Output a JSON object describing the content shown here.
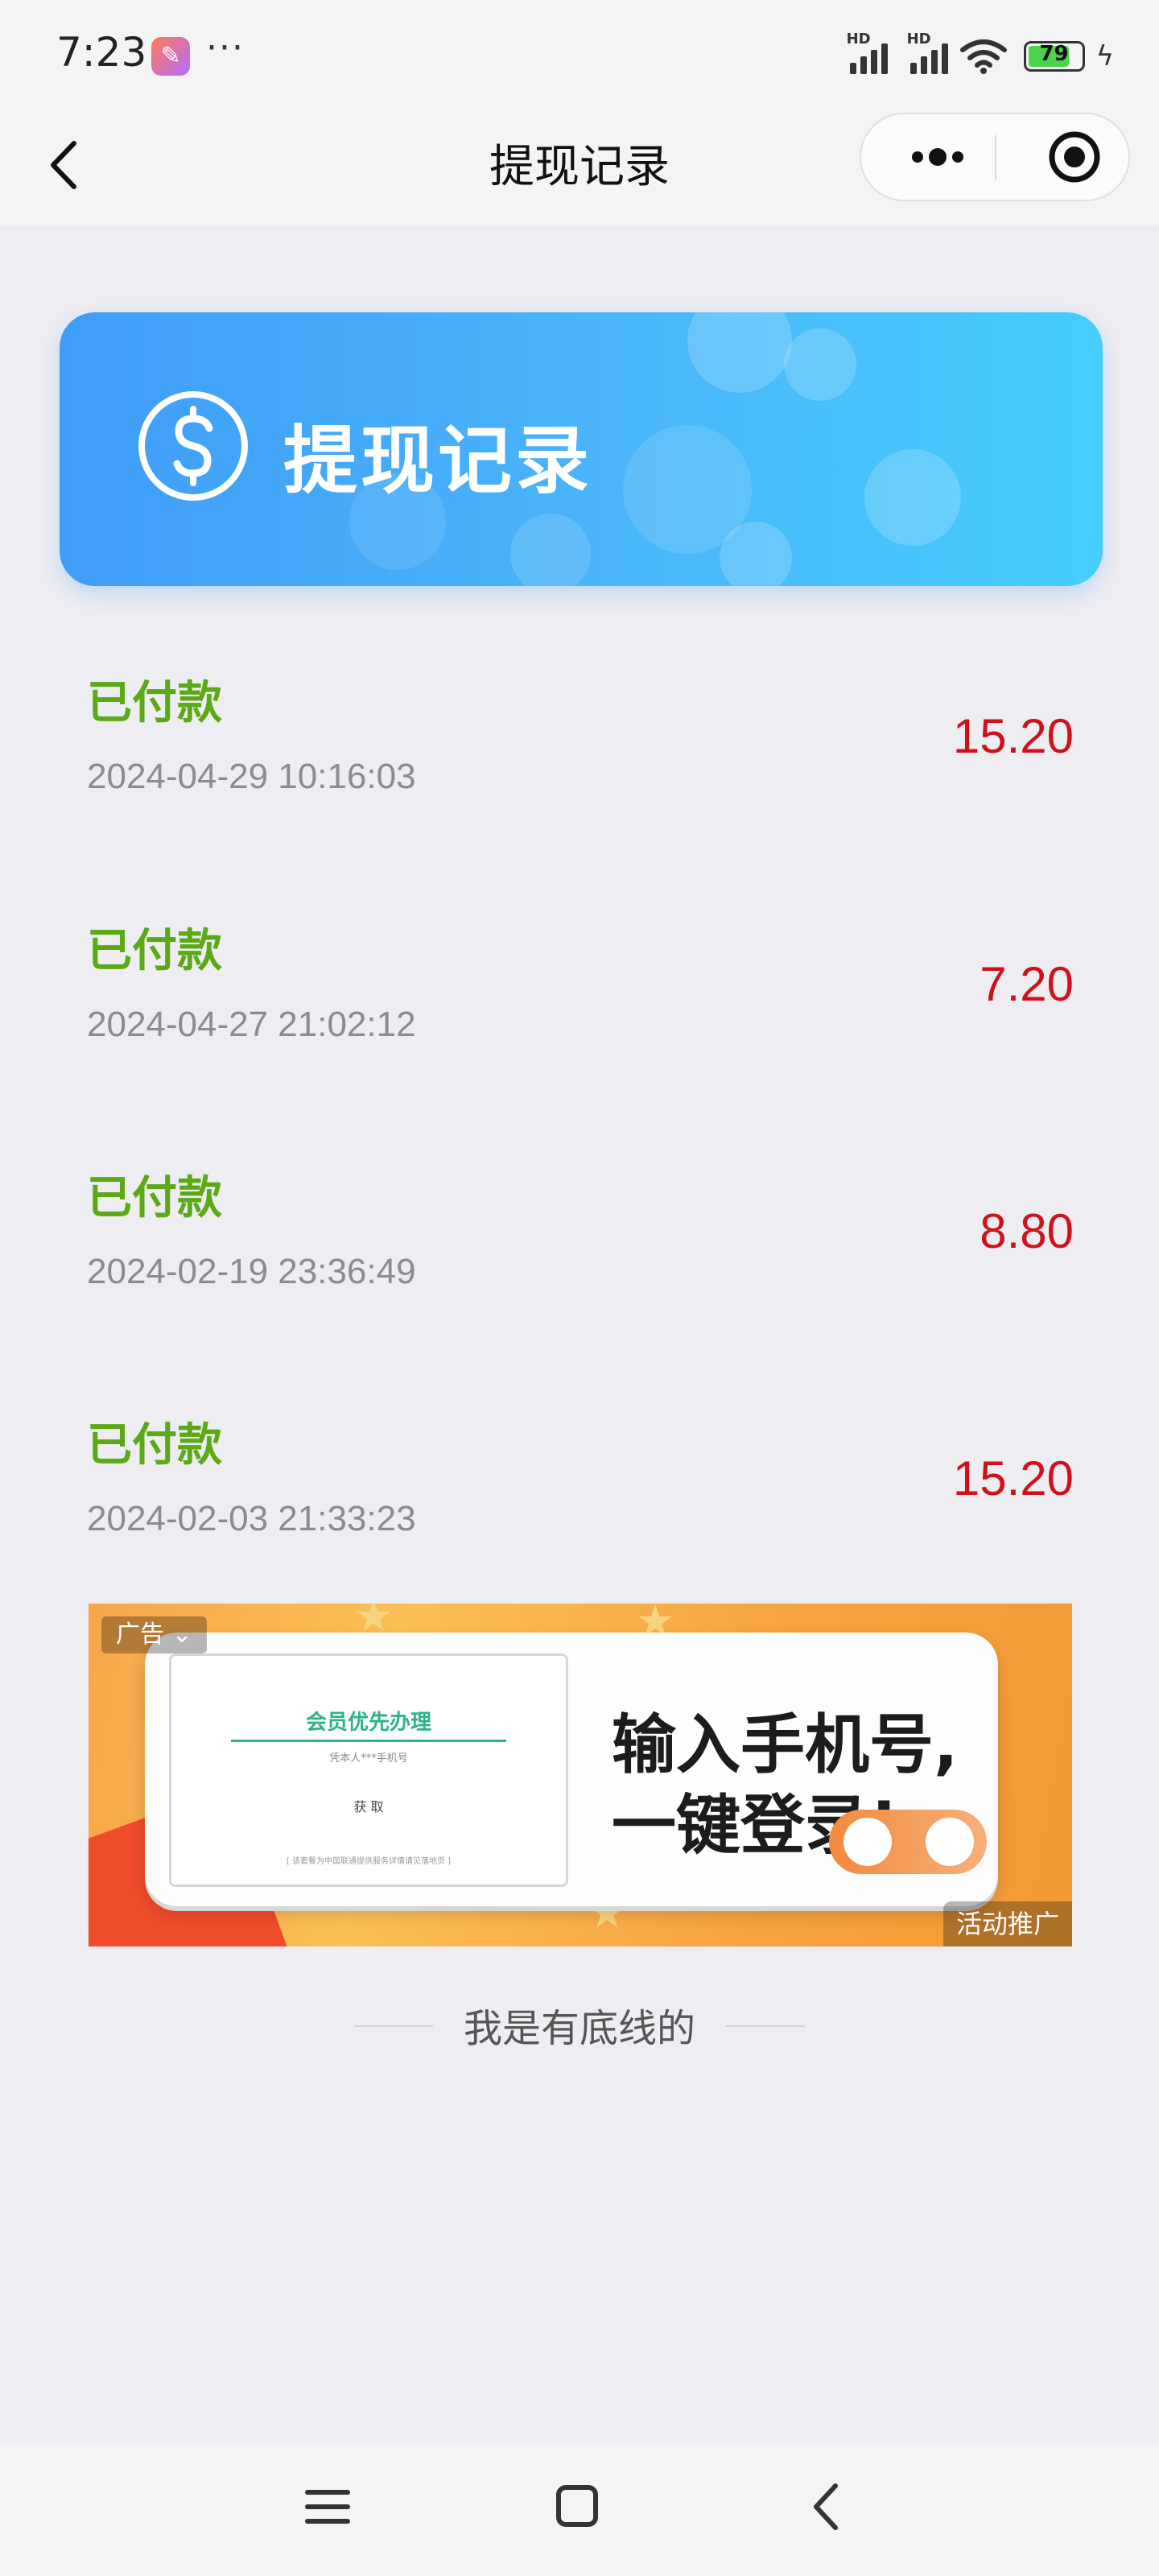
{
  "status_bar": {
    "time": "7:23",
    "hd1": "HD",
    "hd2": "HD",
    "battery": "79"
  },
  "navbar": {
    "title": "提现记录"
  },
  "banner": {
    "title": "提现记录"
  },
  "records": [
    {
      "status": "已付款",
      "time": "2024-04-29 10:16:03",
      "amount": "15.20"
    },
    {
      "status": "已付款",
      "time": "2024-04-27 21:02:12",
      "amount": "7.20"
    },
    {
      "status": "已付款",
      "time": "2024-02-19 23:36:49",
      "amount": "8.80"
    },
    {
      "status": "已付款",
      "time": "2024-02-03 21:33:23",
      "amount": "15.20"
    }
  ],
  "ad": {
    "tag": "广告",
    "inner_title": "会员优先办理",
    "inner_sub": "凭本人***手机号",
    "inner_btn": "获 取",
    "inner_foot": "[ 该套餐为中国联通提供服务详情请见落地页 ]",
    "headline_1": "输入手机号,",
    "headline_2": "一键登录!",
    "promo": "活动推广"
  },
  "footer": {
    "bottom_line": "我是有底线的"
  },
  "colors": {
    "status_paid": "#5aa915",
    "amount": "#d0101a",
    "banner_start": "#3f9df7",
    "banner_end": "#46cefc"
  }
}
